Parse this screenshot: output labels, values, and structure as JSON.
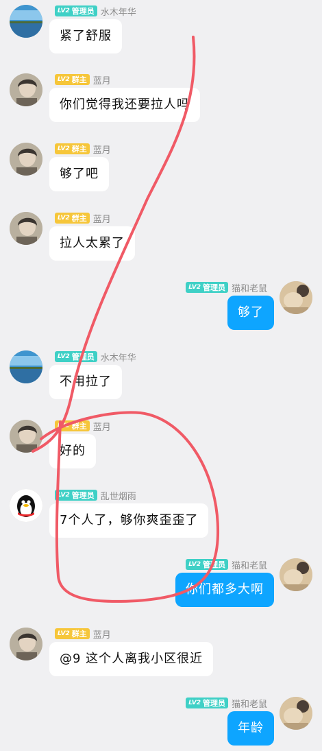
{
  "badges": {
    "admin": {
      "level": "LV2",
      "title": "管理员"
    },
    "owner": {
      "level": "LV2",
      "title": "群主"
    }
  },
  "colors": {
    "self_bubble": "#0ea5ff",
    "other_bubble": "#ffffff",
    "admin_badge": "#3fd0c6",
    "owner_badge": "#f6c63a",
    "annotation_stroke": "#f05a66"
  },
  "messages": [
    {
      "side": "left",
      "avatar": "landscape",
      "role": "admin",
      "sender": "水木年华",
      "text": "紧了舒服"
    },
    {
      "side": "left",
      "avatar": "person",
      "role": "owner",
      "sender": "蓝月",
      "text": "你们觉得我还要拉人吗"
    },
    {
      "side": "left",
      "avatar": "person",
      "role": "owner",
      "sender": "蓝月",
      "text": "够了吧"
    },
    {
      "side": "left",
      "avatar": "person",
      "role": "owner",
      "sender": "蓝月",
      "text": "拉人太累了"
    },
    {
      "side": "right",
      "avatar": "photo",
      "role": "admin",
      "sender": "猫和老鼠",
      "text": "够了"
    },
    {
      "side": "left",
      "avatar": "landscape",
      "role": "admin",
      "sender": "水木年华",
      "text": "不用拉了"
    },
    {
      "side": "left",
      "avatar": "person",
      "role": "owner",
      "sender": "蓝月",
      "text": "好的"
    },
    {
      "side": "left",
      "avatar": "penguin",
      "role": "admin",
      "sender": "乱世烟雨",
      "text": "7个人了，够你爽歪歪了"
    },
    {
      "side": "right",
      "avatar": "photo",
      "role": "admin",
      "sender": "猫和老鼠",
      "text": "你们都多大啊"
    },
    {
      "side": "left",
      "avatar": "person",
      "role": "owner",
      "sender": "蓝月",
      "text": "@9 这个人离我小区很近"
    },
    {
      "side": "right",
      "avatar": "photo",
      "role": "admin",
      "sender": "猫和老鼠",
      "text": "年龄"
    }
  ]
}
